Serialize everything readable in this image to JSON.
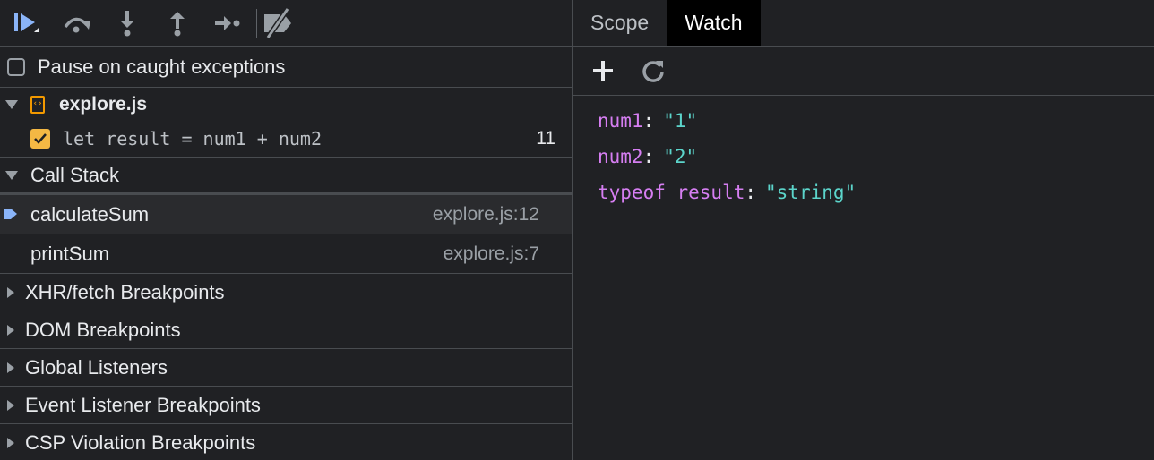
{
  "toolbar": {
    "buttons": [
      {
        "icon": "resume-icon"
      },
      {
        "icon": "step-over-icon"
      },
      {
        "icon": "step-into-icon"
      },
      {
        "icon": "step-out-icon"
      },
      {
        "icon": "step-icon"
      },
      {
        "icon": "deactivate-breakpoints-icon"
      }
    ]
  },
  "pause_on_caught": {
    "label": "Pause on caught exceptions",
    "checked": false
  },
  "breakpoints": {
    "file": "explore.js",
    "items": [
      {
        "code": "let result = num1 + num2",
        "line": "11",
        "checked": true
      }
    ]
  },
  "call_stack": {
    "title": "Call Stack",
    "frames": [
      {
        "name": "calculateSum",
        "location": "explore.js:12",
        "active": true
      },
      {
        "name": "printSum",
        "location": "explore.js:7",
        "active": false
      }
    ]
  },
  "sections": [
    {
      "label": "XHR/fetch Breakpoints"
    },
    {
      "label": "DOM Breakpoints"
    },
    {
      "label": "Global Listeners"
    },
    {
      "label": "Event Listener Breakpoints"
    },
    {
      "label": "CSP Violation Breakpoints"
    }
  ],
  "right_tabs": [
    {
      "label": "Scope",
      "active": false
    },
    {
      "label": "Watch",
      "active": true
    }
  ],
  "watch": {
    "items": [
      {
        "name": "num1",
        "value": "\"1\""
      },
      {
        "name": "num2",
        "value": "\"2\""
      },
      {
        "name": "typeof result",
        "value": "\"string\""
      }
    ]
  },
  "colors": {
    "background": "#202124",
    "border": "#494c50",
    "accent_blue": "#8ab4f8",
    "breakpoint_orange": "#f4b844",
    "watch_name": "#d67ef2",
    "watch_value": "#5cd5cb"
  }
}
